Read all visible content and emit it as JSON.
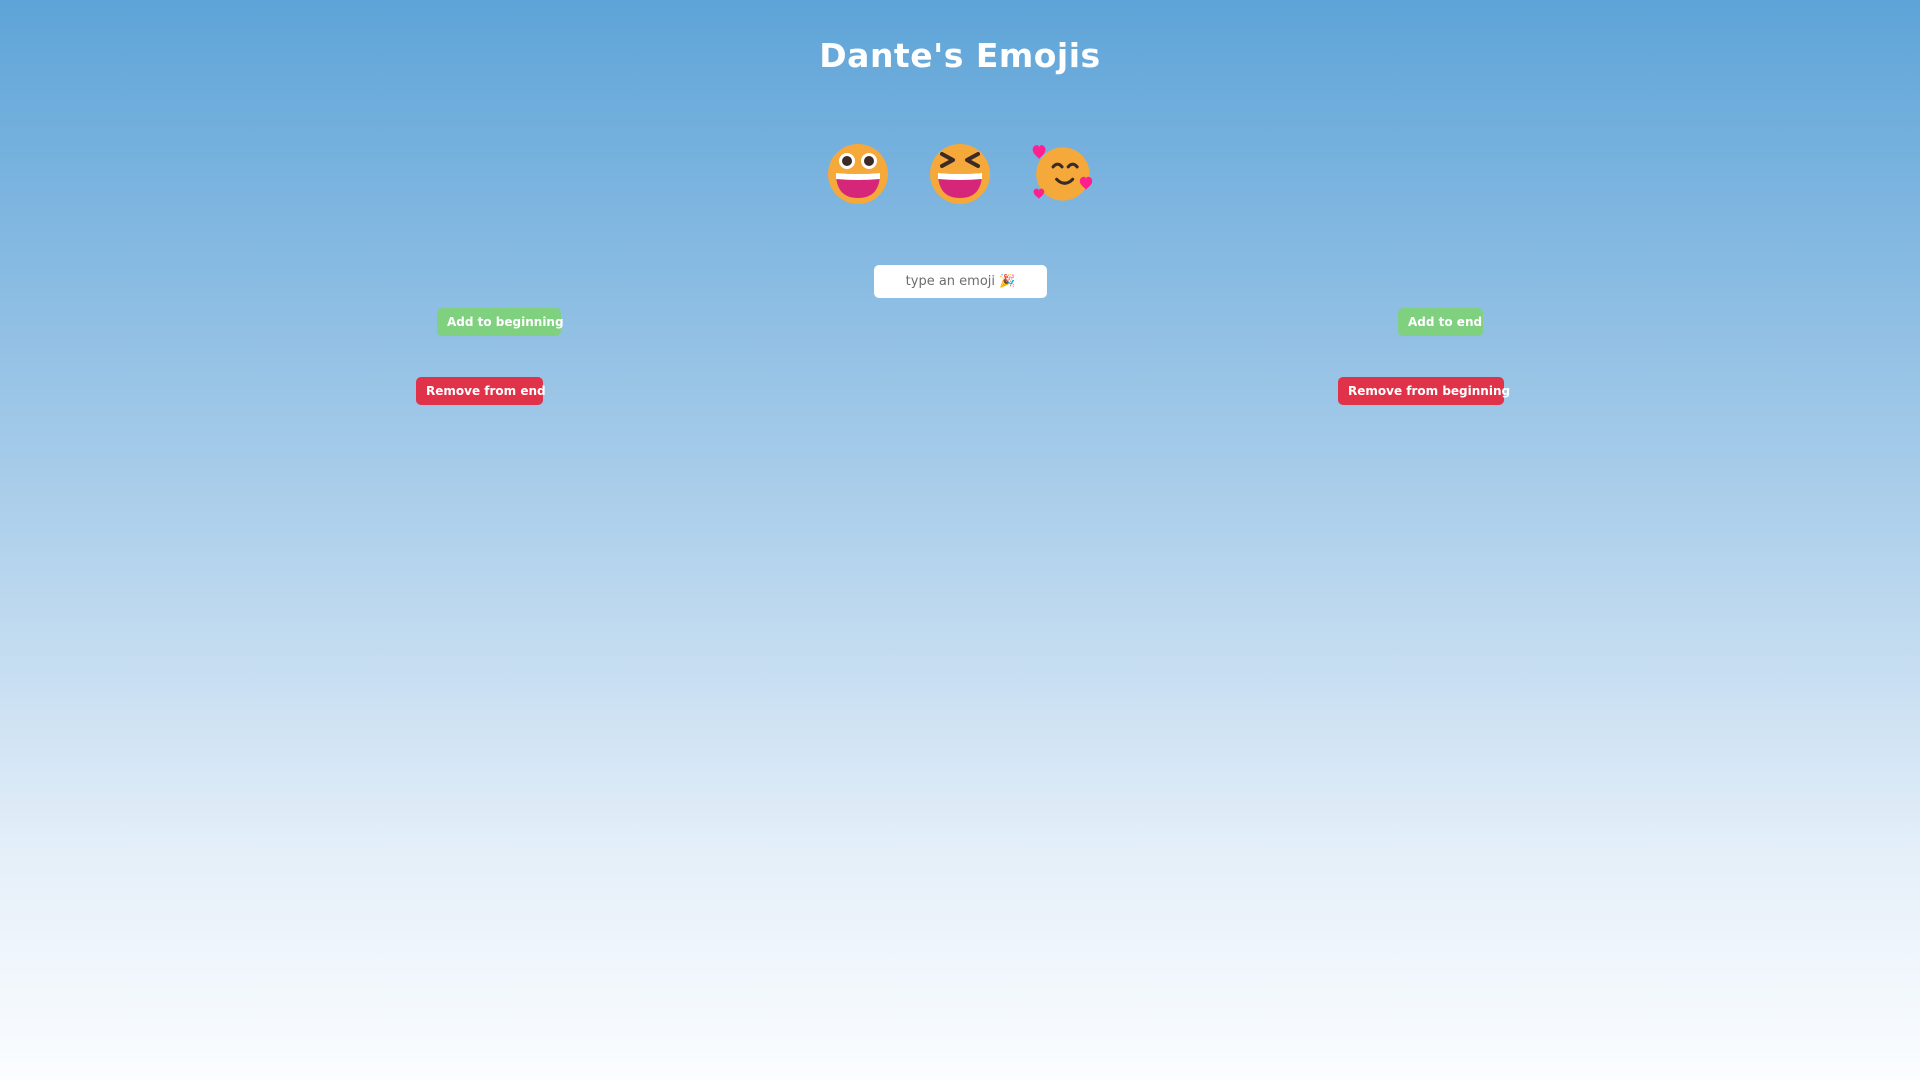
{
  "header": {
    "title": "Dante's Emojis"
  },
  "emojis": [
    {
      "name": "grinning-face-big-eyes",
      "icon": "grinning-face-with-big-eyes-icon"
    },
    {
      "name": "grinning-squinting-face",
      "icon": "grinning-squinting-face-icon"
    },
    {
      "name": "smiling-face-with-hearts",
      "icon": "smiling-face-with-hearts-icon"
    }
  ],
  "input": {
    "placeholder": "type an emoji 🎉",
    "value": ""
  },
  "buttons": {
    "add_to_beginning": "Add to beginning",
    "add_to_end": "Add to end",
    "remove_from_end": "Remove from end",
    "remove_from_beginning": "Remove from beginning"
  },
  "colors": {
    "add_button": "#7fd17f",
    "remove_button": "#e0334a",
    "emoji_face": "#f6a93b",
    "heart": "#ff1f8e",
    "mouth": "#d6267a"
  }
}
